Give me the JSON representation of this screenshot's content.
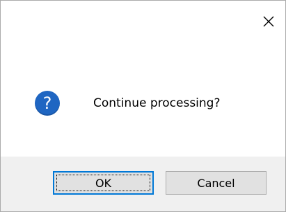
{
  "dialog": {
    "message": "Continue processing?",
    "icon": "question-icon",
    "icon_glyph": "?",
    "close_glyph": "✕",
    "buttons": {
      "ok_label": "OK",
      "cancel_label": "Cancel"
    }
  },
  "colors": {
    "accent": "#0078d7",
    "icon_bg": "#1f66c2",
    "footer_bg": "#f0f0f0",
    "button_bg": "#e1e1e1"
  }
}
